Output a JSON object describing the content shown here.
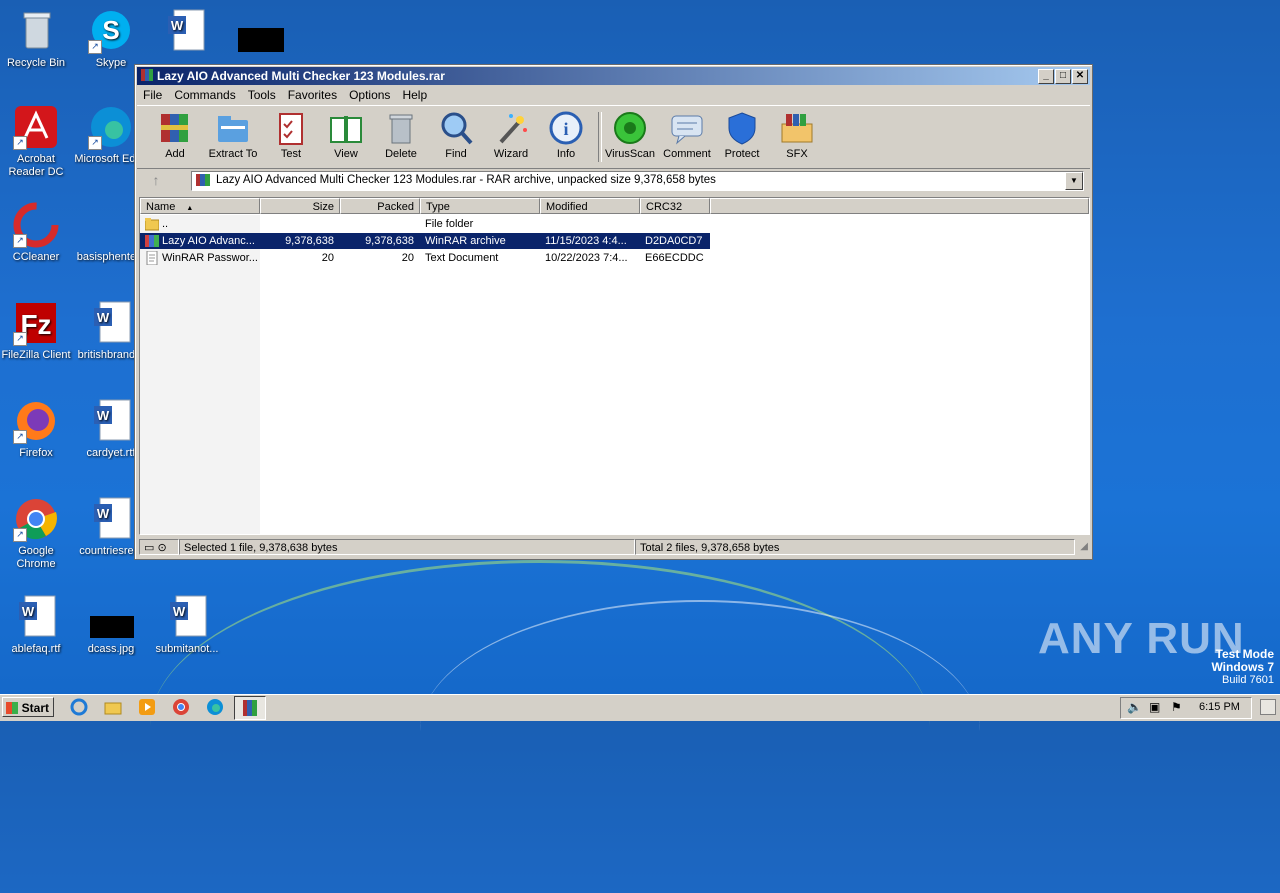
{
  "desktop": {
    "icons": [
      {
        "label": "Recycle Bin"
      },
      {
        "label": "Skype"
      },
      {
        "label": "Acrobat Reader DC"
      },
      {
        "label": "Microsoft Edge"
      },
      {
        "label": "CCleaner"
      },
      {
        "label": "basisphente..."
      },
      {
        "label": "FileZilla Client"
      },
      {
        "label": "britishbrand..."
      },
      {
        "label": "Firefox"
      },
      {
        "label": "cardyet.rtf"
      },
      {
        "label": "Google Chrome"
      },
      {
        "label": "countriesre..."
      },
      {
        "label": "ablefaq.rtf"
      },
      {
        "label": "dcass.jpg"
      },
      {
        "label": "submitanot..."
      }
    ]
  },
  "window": {
    "title": "Lazy AIO Advanced Multi Checker 123 Modules.rar",
    "menu": [
      "File",
      "Commands",
      "Tools",
      "Favorites",
      "Options",
      "Help"
    ],
    "toolbar": [
      "Add",
      "Extract To",
      "Test",
      "View",
      "Delete",
      "Find",
      "Wizard",
      "Info",
      "VirusScan",
      "Comment",
      "Protect",
      "SFX"
    ],
    "address": "Lazy AIO Advanced Multi Checker 123 Modules.rar - RAR archive, unpacked size 9,378,658 bytes",
    "columns": [
      "Name",
      "Size",
      "Packed",
      "Type",
      "Modified",
      "CRC32"
    ],
    "rows": [
      {
        "name": "..",
        "size": "",
        "packed": "",
        "type": "File folder",
        "modified": "",
        "crc": ""
      },
      {
        "name": "Lazy AIO Advanc...",
        "size": "9,378,638",
        "packed": "9,378,638",
        "type": "WinRAR archive",
        "modified": "11/15/2023 4:4...",
        "crc": "D2DA0CD7"
      },
      {
        "name": "WinRAR Passwor...",
        "size": "20",
        "packed": "20",
        "type": "Text Document",
        "modified": "10/22/2023 7:4...",
        "crc": "E66ECDDC"
      }
    ],
    "status_left": "Selected 1 file, 9,378,638 bytes",
    "status_right": "Total 2 files, 9,378,658 bytes"
  },
  "taskbar": {
    "start_label": "Start",
    "clock": "6:15 PM"
  },
  "watermark": {
    "brand": "ANY RUN",
    "line1": "Test Mode",
    "line2": "Windows 7",
    "line3": "Build 7601"
  },
  "colors": {
    "selection": "#0a246a",
    "titlebar": "#0a246a",
    "desktop": "#1b6fd0"
  }
}
